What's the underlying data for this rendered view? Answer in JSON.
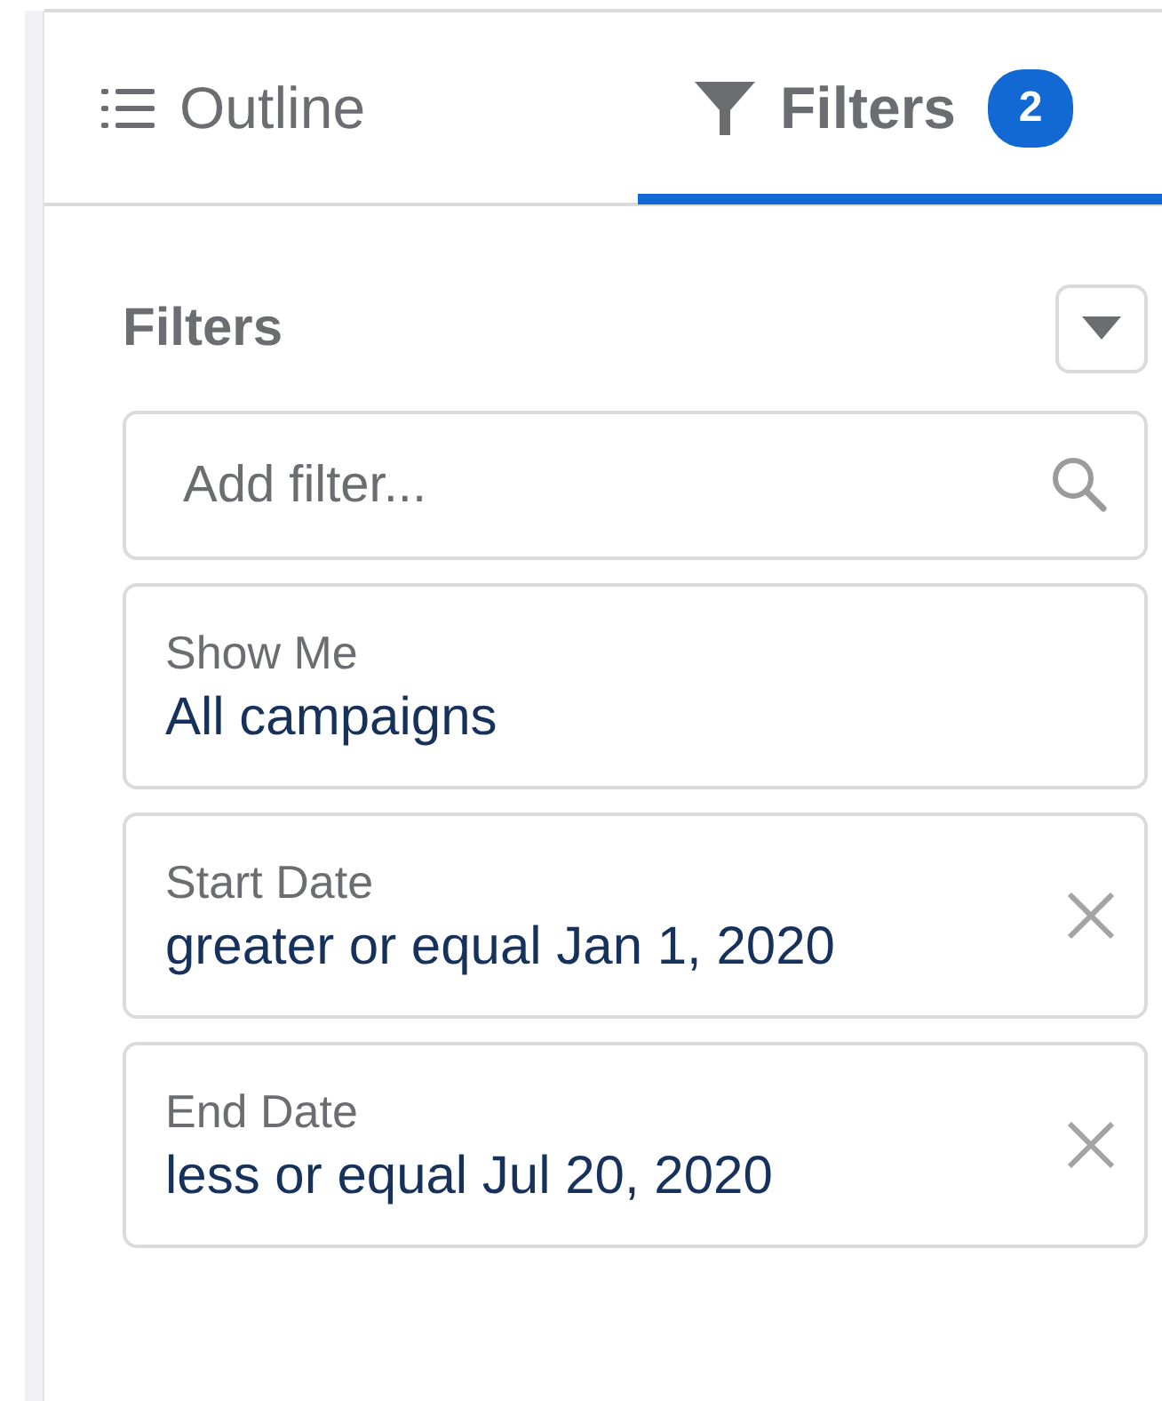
{
  "tabs": [
    {
      "label": "Outline",
      "kind": "list",
      "selected": false
    },
    {
      "label": "Filters",
      "kind": "funnel",
      "badge": "2",
      "selected": true
    }
  ],
  "panel": {
    "title": "Filters"
  },
  "search": {
    "placeholder": "Add filter..."
  },
  "filters": [
    {
      "label": "Show Me",
      "value": "All campaigns",
      "removable": false
    },
    {
      "label": "Start Date",
      "value": "greater or equal Jan 1, 2020",
      "removable": true
    },
    {
      "label": "End Date",
      "value": "less or equal Jul 20, 2020",
      "removable": true
    }
  ]
}
